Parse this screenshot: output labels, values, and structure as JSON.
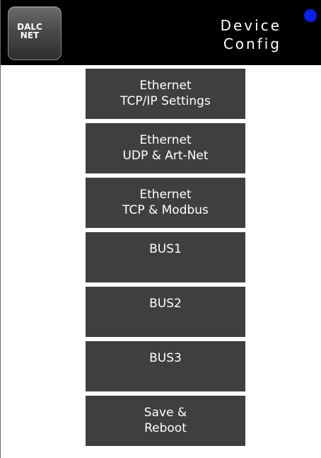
{
  "header": {
    "logo_line1": "DALC",
    "logo_line2": "NET",
    "title_line1": "Device",
    "title_line2": "Config",
    "status_color": "#0a1ff0"
  },
  "menu": {
    "items": [
      {
        "line1": "Ethernet",
        "line2": "TCP/IP Settings"
      },
      {
        "line1": "Ethernet",
        "line2": "UDP & Art-Net"
      },
      {
        "line1": "Ethernet",
        "line2": "TCP & Modbus"
      },
      {
        "line1": "BUS1",
        "line2": ""
      },
      {
        "line1": "BUS2",
        "line2": ""
      },
      {
        "line1": "BUS3",
        "line2": ""
      },
      {
        "line1": "Save &",
        "line2": "Reboot"
      }
    ]
  },
  "colors": {
    "header_bg": "#000000",
    "button_bg": "#3f3f3f",
    "button_text": "#ffffff"
  }
}
